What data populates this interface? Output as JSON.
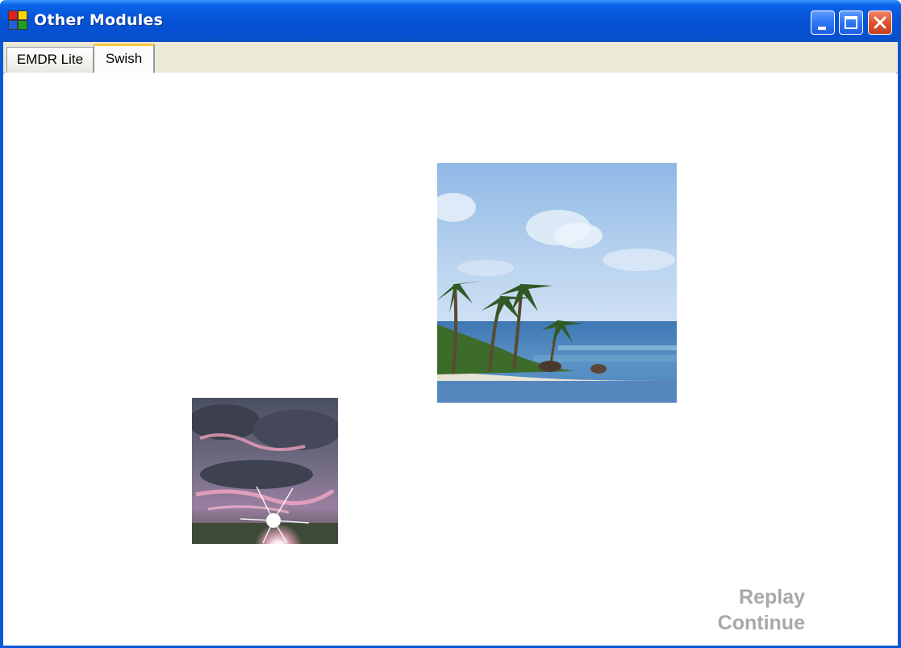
{
  "window": {
    "title": "Other Modules",
    "icon": "app-window-icon",
    "controls": {
      "minimize_icon": "minimize-icon",
      "maximize_icon": "maximize-icon",
      "close_icon": "close-icon"
    }
  },
  "tabs": [
    {
      "label": "EMDR Lite",
      "active": false
    },
    {
      "label": "Swish",
      "active": true
    }
  ],
  "swish": {
    "images": [
      {
        "name": "tropical-beach-photo",
        "description_icon": "beach-image"
      },
      {
        "name": "sunset-clouds-photo",
        "description_icon": "sunset-image"
      }
    ],
    "actions": {
      "replay_label": "Replay",
      "continue_label": "Continue"
    }
  },
  "colors": {
    "titlebar": "#0553d6",
    "action_text": "#a8a8a8",
    "active_tab_accent": "#ffc83c"
  }
}
